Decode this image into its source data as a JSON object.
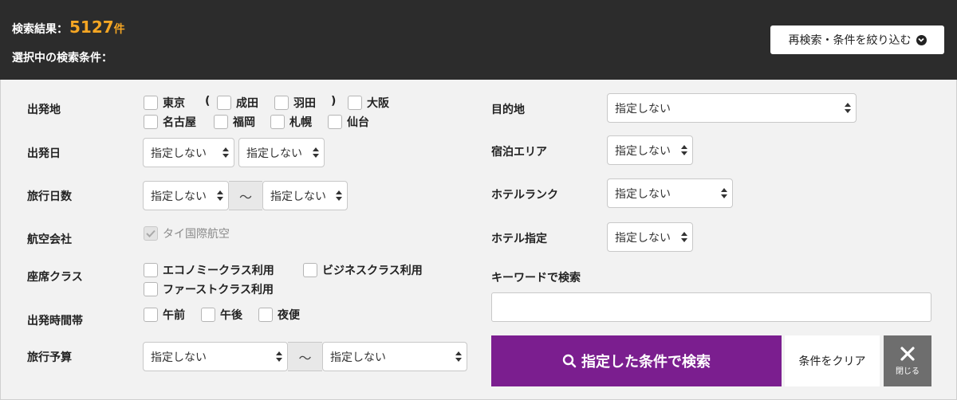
{
  "header": {
    "result_label": "検索結果：",
    "result_count": "5127",
    "result_unit": "件",
    "conditions_label": "選択中の検索条件：",
    "refine_button": "再検索・条件を絞り込む"
  },
  "form": {
    "departure": {
      "label": "出発地",
      "open_paren": "(",
      "close_paren": ")",
      "options": [
        "東京",
        "成田",
        "羽田",
        "大阪",
        "名古屋",
        "福岡",
        "札幌",
        "仙台"
      ]
    },
    "departure_date": {
      "label": "出発日",
      "select1": "指定しない",
      "select2": "指定しない"
    },
    "travel_days": {
      "label": "旅行日数",
      "from": "指定しない",
      "to": "指定しない",
      "separator": "〜"
    },
    "airline": {
      "label": "航空会社",
      "option": "タイ国際航空",
      "checked": true
    },
    "seat_class": {
      "label": "座席クラス",
      "options": [
        "エコノミークラス利用",
        "ビジネスクラス利用",
        "ファーストクラス利用"
      ]
    },
    "departure_time": {
      "label": "出発時間帯",
      "options": [
        "午前",
        "午後",
        "夜便"
      ]
    },
    "budget": {
      "label": "旅行予算",
      "from": "指定しない",
      "to": "指定しない",
      "separator": "〜"
    },
    "destination": {
      "label": "目的地",
      "value": "指定しない"
    },
    "stay_area": {
      "label": "宿泊エリア",
      "value": "指定しない"
    },
    "hotel_rank": {
      "label": "ホテルランク",
      "value": "指定しない"
    },
    "hotel_specify": {
      "label": "ホテル指定",
      "value": "指定しない"
    },
    "keyword": {
      "label": "キーワードで検索",
      "value": ""
    }
  },
  "actions": {
    "search": "指定した条件で検索",
    "clear": "条件をクリア",
    "close": "閉じる"
  },
  "colors": {
    "header_bg": "#2c2c2c",
    "count": "#f5a623",
    "search_button": "#7b1e8f",
    "close_button": "#6e6e6e"
  }
}
